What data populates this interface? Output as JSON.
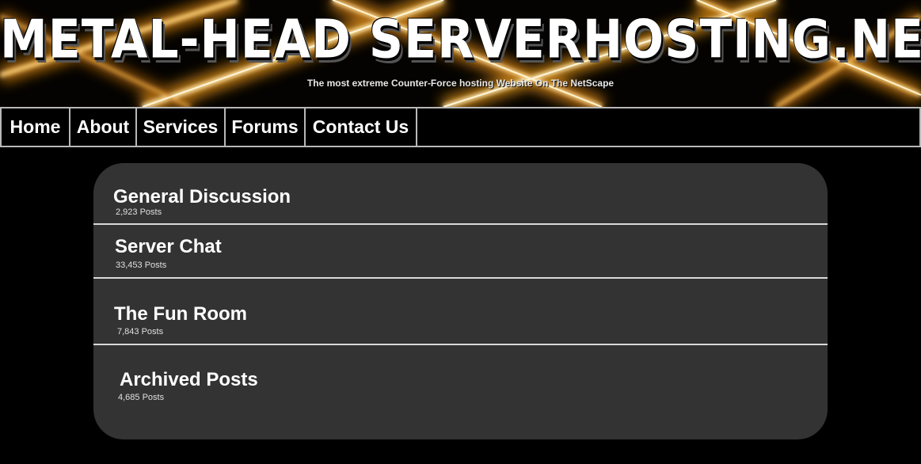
{
  "header": {
    "site_title": "METAL-HEAD SERVERHOSTING.NET",
    "tagline": "The most extreme Counter-Force hosting Website On The NetScape"
  },
  "nav": {
    "items": [
      {
        "label": "Home"
      },
      {
        "label": "About"
      },
      {
        "label": "Services"
      },
      {
        "label": "Forums"
      },
      {
        "label": "Contact Us"
      }
    ]
  },
  "forums": [
    {
      "title": "General Discussion",
      "posts": "2,923 Posts"
    },
    {
      "title": "Server Chat",
      "posts": "33,453 Posts"
    },
    {
      "title": "The Fun Room",
      "posts": "7,843 Posts"
    },
    {
      "title": "Archived Posts",
      "posts": "4,685 Posts"
    }
  ],
  "colors": {
    "page_background": "#000000",
    "panel_background": "#333333",
    "nav_border": "#b8b8b8",
    "banner_glow": "#f5a623"
  }
}
